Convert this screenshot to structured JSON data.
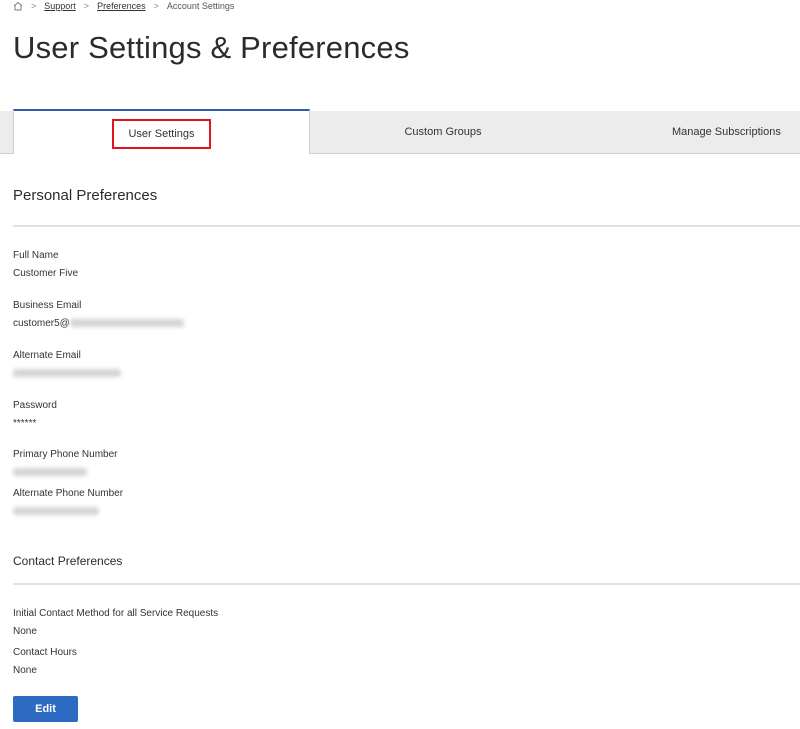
{
  "breadcrumb": {
    "home_icon": "home-icon",
    "items": [
      "Support",
      "Preferences",
      "Account Settings"
    ]
  },
  "page_title": "User Settings & Preferences",
  "tabs": [
    {
      "label": "User Settings",
      "active": true
    },
    {
      "label": "Custom Groups",
      "active": false
    },
    {
      "label": "Manage Subscriptions",
      "active": false
    }
  ],
  "personal": {
    "title": "Personal Preferences",
    "full_name_label": "Full Name",
    "full_name_value": "Customer Five",
    "business_email_label": "Business Email",
    "business_email_value": "customer5@",
    "alternate_email_label": "Alternate Email",
    "password_label": "Password",
    "password_value": "******",
    "primary_phone_label": "Primary Phone Number",
    "alternate_phone_label": "Alternate Phone Number"
  },
  "contact": {
    "title": "Contact Preferences",
    "initial_method_label": "Initial Contact Method for all Service Requests",
    "initial_method_value": "None",
    "hours_label": "Contact Hours",
    "hours_value": "None"
  },
  "edit_label": "Edit",
  "colors": {
    "accent": "#2d6ac1",
    "tab_border": "#2d5fa8",
    "highlight": "#e0141e"
  }
}
